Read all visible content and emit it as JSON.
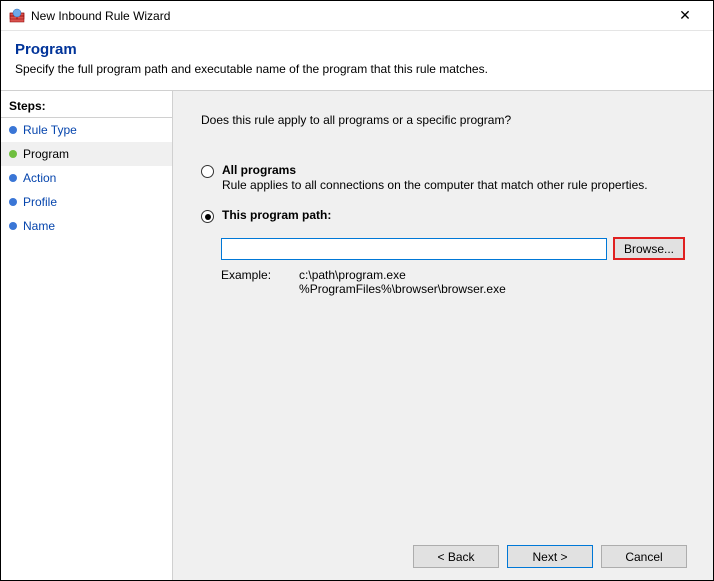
{
  "window": {
    "title": "New Inbound Rule Wizard",
    "close_label": "✕"
  },
  "header": {
    "title": "Program",
    "description": "Specify the full program path and executable name of the program that this rule matches."
  },
  "sidebar": {
    "steps_label": "Steps:",
    "items": [
      {
        "label": "Rule Type"
      },
      {
        "label": "Program"
      },
      {
        "label": "Action"
      },
      {
        "label": "Profile"
      },
      {
        "label": "Name"
      }
    ]
  },
  "main": {
    "question": "Does this rule apply to all programs or a specific program?",
    "option_all": {
      "title": "All programs",
      "subtitle": "Rule applies to all connections on the computer that match other rule properties."
    },
    "option_path": {
      "title": "This program path:",
      "input_value": "",
      "browse_label": "Browse...",
      "example_label": "Example:",
      "example_values": "c:\\path\\program.exe\n%ProgramFiles%\\browser\\browser.exe"
    }
  },
  "footer": {
    "back": "< Back",
    "next": "Next >",
    "cancel": "Cancel"
  }
}
